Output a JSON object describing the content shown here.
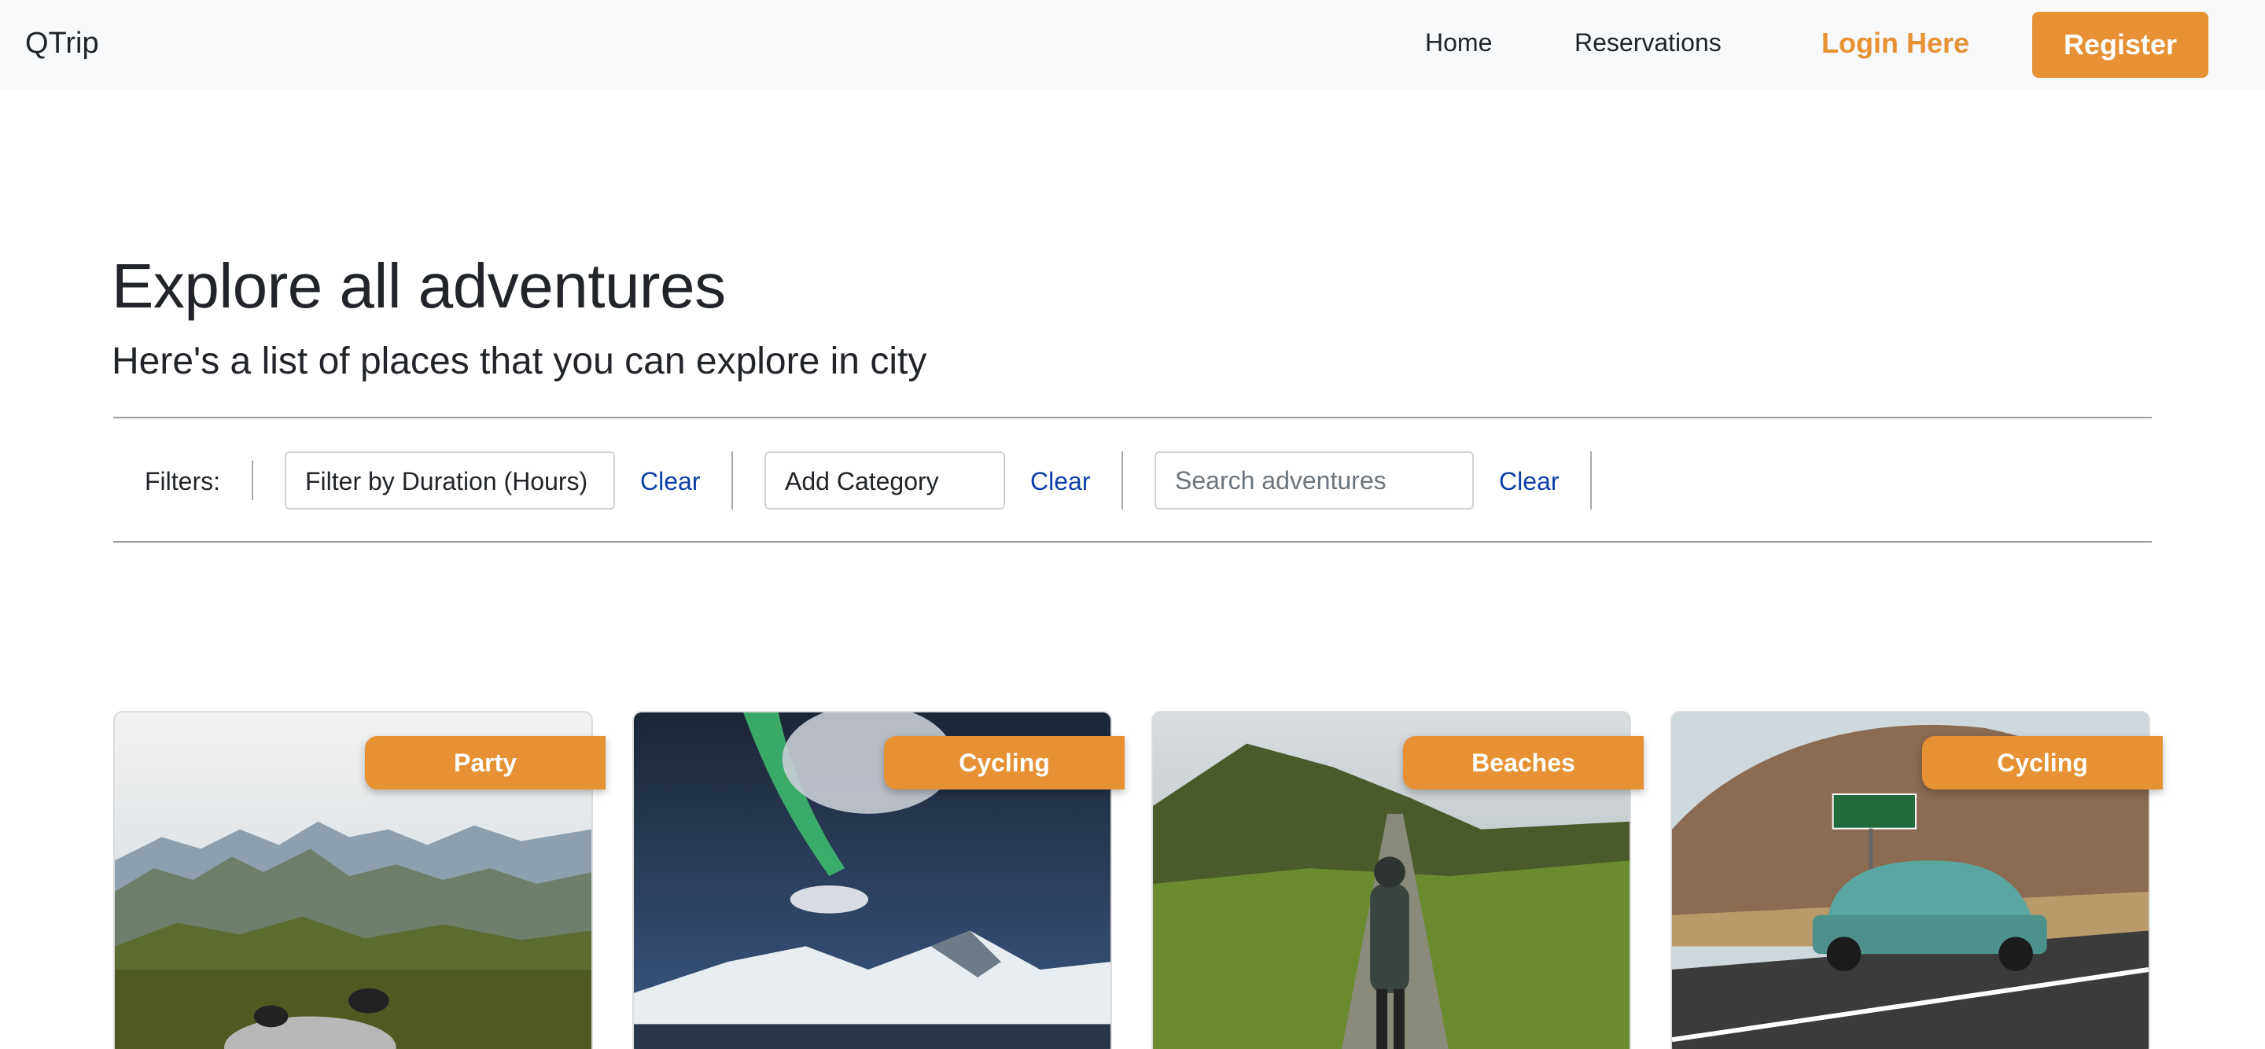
{
  "navbar": {
    "brand": "QTrip",
    "links": {
      "home": "Home",
      "reservations": "Reservations"
    },
    "login": "Login Here",
    "register": "Register"
  },
  "header": {
    "title": "Explore all adventures",
    "subtitle": "Here's a list of places that you can explore in city"
  },
  "filters": {
    "label": "Filters:",
    "duration_select": "Filter by Duration (Hours)",
    "category_select": "Add Category",
    "search_placeholder": "Search adventures",
    "clear_label": "Clear"
  },
  "cards": [
    {
      "category": "Party",
      "image": "mountain-valley-photo"
    },
    {
      "category": "Cycling",
      "image": "aurora-photo"
    },
    {
      "category": "Beaches",
      "image": "hiker-path-photo"
    },
    {
      "category": "Cycling",
      "image": "vintage-car-photo"
    }
  ],
  "colors": {
    "accent": "#e59134",
    "link": "#0d3fa8",
    "navbar_bg": "#f8f9fa"
  }
}
